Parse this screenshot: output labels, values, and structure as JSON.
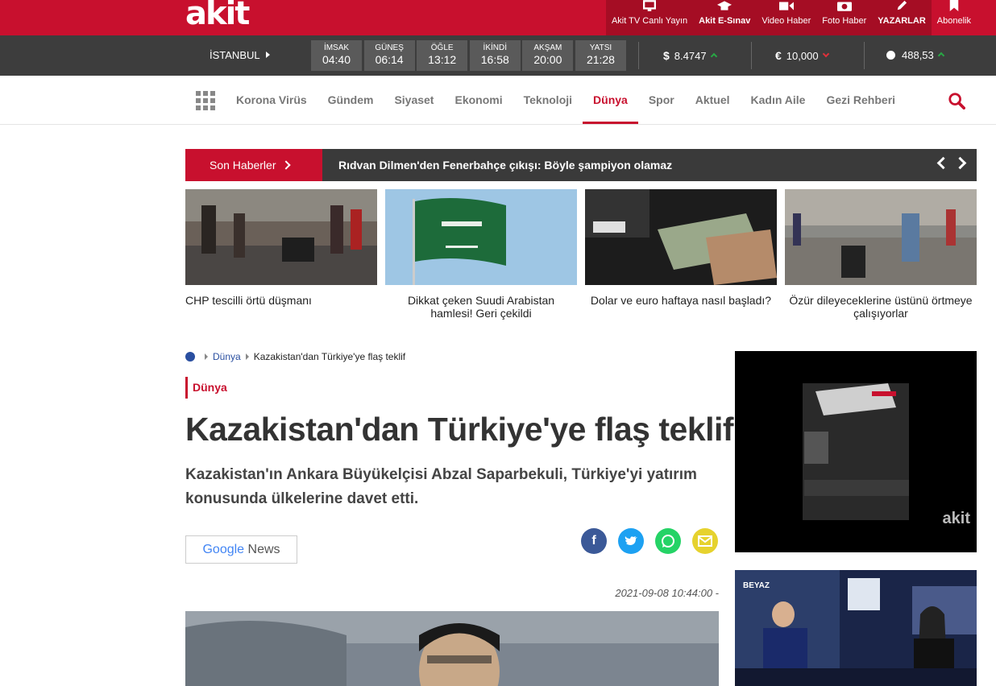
{
  "brand": {
    "logo": "akit",
    "accent": "#c8102e",
    "dark": "#3d3d3d"
  },
  "topnav": [
    {
      "label": "Akit TV Canlı Yayın",
      "icon": "tv-icon"
    },
    {
      "label": "Akit E-Sınav",
      "icon": "graduation-cap-icon"
    },
    {
      "label": "Video Haber",
      "icon": "video-camera-icon"
    },
    {
      "label": "Foto Haber",
      "icon": "camera-icon"
    },
    {
      "label": "YAZARLAR",
      "icon": "pen-icon"
    },
    {
      "label": "Abonelik",
      "icon": "bookmark-icon"
    }
  ],
  "prayer": {
    "city": "İSTANBUL",
    "times": [
      {
        "name": "İMSAK",
        "time": "04:40"
      },
      {
        "name": "GÜNEŞ",
        "time": "06:14"
      },
      {
        "name": "ÖĞLE",
        "time": "13:12"
      },
      {
        "name": "İKİNDİ",
        "time": "16:58"
      },
      {
        "name": "AKŞAM",
        "time": "20:00"
      },
      {
        "name": "YATSI",
        "time": "21:28"
      }
    ]
  },
  "currency": [
    {
      "symbol": "$",
      "value": "8.4747",
      "trend": "up"
    },
    {
      "symbol": "€",
      "value": "10,000",
      "trend": "down"
    },
    {
      "symbol": "",
      "value": "488,53",
      "trend": "up"
    }
  ],
  "nav": {
    "items": [
      "Korona Virüs",
      "Gündem",
      "Siyaset",
      "Ekonomi",
      "Teknoloji",
      "Dünya",
      "Spor",
      "Aktuel",
      "Kadın Aile",
      "Gezi Rehberi"
    ],
    "active": "Dünya"
  },
  "son": {
    "label": "Son Haberler",
    "headline": "Rıdvan Dilmen'den Fenerbahçe çıkışı: Böyle şampiyon olamaz"
  },
  "cards": [
    {
      "caption": "CHP tescilli örtü düşmanı"
    },
    {
      "caption": "Dikkat çeken Suudi Arabistan hamlesi! Geri çekildi"
    },
    {
      "caption": "Dolar ve euro haftaya nasıl başladı?"
    },
    {
      "caption": "Özür dileyeceklerine üstünü örtmeye çalışıyorlar"
    }
  ],
  "breadcrumb": {
    "section": "Dünya",
    "current": "Kazakistan'dan Türkiye'ye flaş teklif"
  },
  "article": {
    "category": "Dünya",
    "title": "Kazakistan'dan Türkiye'ye flaş teklif",
    "spot": "Kazakistan'ın Ankara Büyükelçisi Abzal Saparbekuli, Türkiye'yi yatırım konusunda ülkelerine davet etti.",
    "gnews": {
      "google": "Google",
      "news": "News"
    },
    "date": "2021-09-08 10:44:00 -"
  },
  "ads": {
    "ad1_logo": "akit",
    "ad2_channel": "BEYAZ"
  }
}
